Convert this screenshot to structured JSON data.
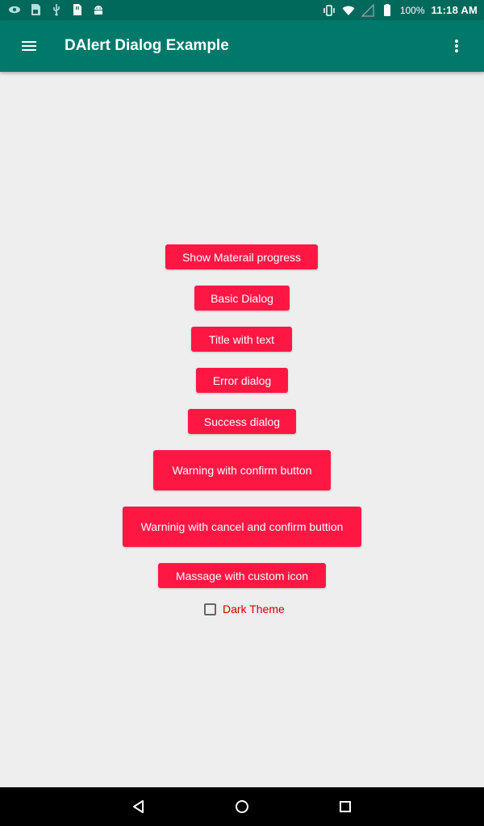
{
  "status_bar": {
    "battery": "100%",
    "time": "11:18 AM",
    "icons_left": [
      "eye-icon",
      "sd-card-icon",
      "usb-icon",
      "sim-card-icon",
      "android-icon"
    ],
    "icons_right": [
      "vibrate-icon",
      "wifi-icon",
      "signal-icon",
      "battery-icon"
    ]
  },
  "toolbar": {
    "title": "DAlert Dialog Example",
    "color": "#00796b"
  },
  "buttons": [
    {
      "label": "Show Materail progress"
    },
    {
      "label": "Basic Dialog"
    },
    {
      "label": "Title with text"
    },
    {
      "label": "Error dialog"
    },
    {
      "label": "Success dialog"
    },
    {
      "label": "Warning with confirm button"
    },
    {
      "label": "Warninig with cancel and confirm buttion"
    },
    {
      "label": "Massage with custom icon"
    }
  ],
  "dark_theme": {
    "label": "Dark Theme",
    "checked": false
  },
  "colors": {
    "accent": "#ff1744",
    "status_bar": "#00695c",
    "checkbox_label": "#d50000",
    "background": "#eeeeee"
  },
  "nav_bar": {
    "icons": [
      "back-icon",
      "home-icon",
      "recents-icon"
    ]
  }
}
